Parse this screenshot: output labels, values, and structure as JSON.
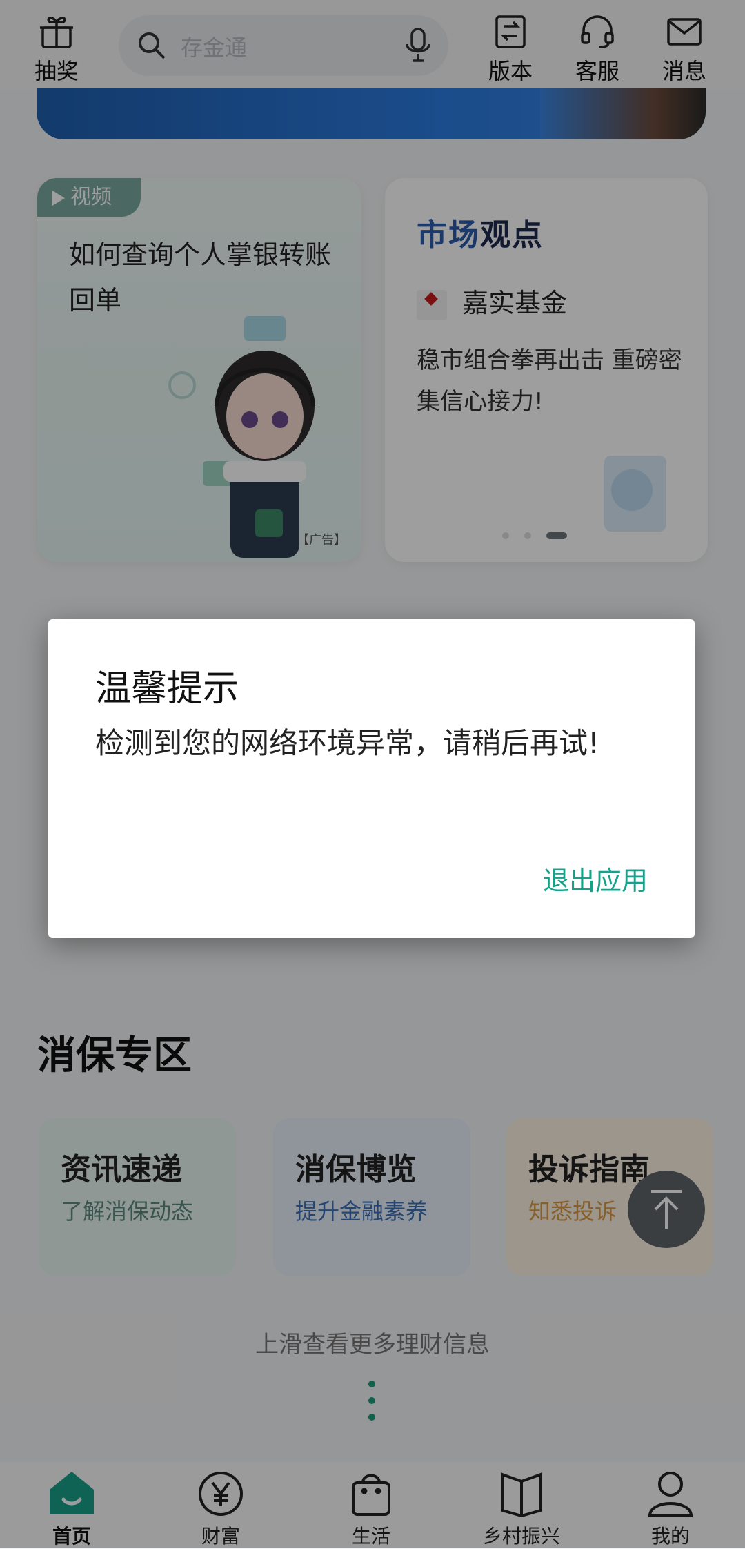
{
  "top_bar": {
    "lottery_label": "抽奖",
    "search_placeholder": "存金通",
    "version_label": "版本",
    "service_label": "客服",
    "messages_label": "消息"
  },
  "cards": {
    "video": {
      "tag": "视频",
      "title": "如何查询个人掌银转账回单",
      "ad_label": "【广告】"
    },
    "market": {
      "heading_part1": "市场",
      "heading_part2": "观点",
      "fund_name": "嘉实基金",
      "description": "稳市组合拳再出击 重磅密集信心接力!"
    }
  },
  "consumer_protection": {
    "title": "消保专区",
    "tiles": [
      {
        "title": "资讯速递",
        "subtitle": "了解消保动态",
        "color": "#5c8a7e"
      },
      {
        "title": "消保博览",
        "subtitle": "提升金融素养",
        "color": "#3d72b8"
      },
      {
        "title": "投诉指南",
        "subtitle": "知悉投诉",
        "color": "#d99a45"
      }
    ]
  },
  "scroll_hint": "上滑查看更多理财信息",
  "bottom_nav": {
    "items": [
      {
        "label": "首页",
        "icon": "home-icon"
      },
      {
        "label": "财富",
        "icon": "yen-icon"
      },
      {
        "label": "生活",
        "icon": "shopping-bag-icon"
      },
      {
        "label": "乡村振兴",
        "icon": "book-icon"
      },
      {
        "label": "我的",
        "icon": "user-icon"
      }
    ]
  },
  "dialog": {
    "title": "温馨提示",
    "message": "检测到您的网络环境异常，请稍后再试!",
    "button": "退出应用"
  },
  "colors": {
    "accent_green": "#17a08a",
    "overlay": "rgba(0,0,0,0.38)"
  }
}
